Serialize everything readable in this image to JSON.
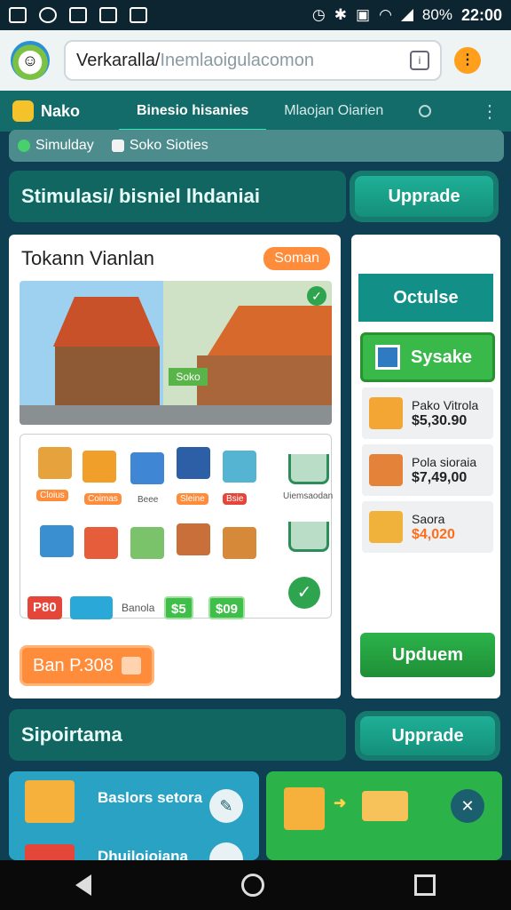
{
  "status_bar": {
    "battery": "80%",
    "time": "22:00"
  },
  "browser": {
    "url_main": "Verkaralla/",
    "url_rest": "Inemlaoigulacomon"
  },
  "nav": {
    "brand": "Nako",
    "tabs": [
      {
        "label": "Binesio hisanies",
        "active": true
      },
      {
        "label": "Mlaojan Oiarien",
        "active": false
      }
    ]
  },
  "chips": [
    {
      "label": "Simulday"
    },
    {
      "label": "Soko Sioties"
    }
  ],
  "banner": {
    "title": "Stimulasi/ bisniel lhdaniai",
    "button": "Upprade"
  },
  "main_card": {
    "title": "Tokann Vianlan",
    "badge": "Soman",
    "scene_sign": "Soko",
    "grid_tags": [
      "Cloius",
      "Coimas",
      "Beee",
      "Sleine",
      "Bsie",
      "Uiemsaodan"
    ],
    "price_red": "P80",
    "price_label": "Banola",
    "price_green1": "$5",
    "price_green2": "$09",
    "buy_button": "Ban P.308"
  },
  "side_panel": {
    "header": "Octulse",
    "tab": "Sysake",
    "products": [
      {
        "name": "Pako Vitrola",
        "price": "$5,30.90"
      },
      {
        "name": "Pola sioraia",
        "price": "$7,49,00"
      },
      {
        "name": "Saora",
        "price": "$4,020"
      }
    ],
    "update_button": "Upduem"
  },
  "banner2": {
    "title": "Sipoirtama",
    "button": "Upprade"
  },
  "bottom_cards": [
    {
      "title": "Baslors setora",
      "subtitle": "Dhuiloioiana"
    }
  ]
}
